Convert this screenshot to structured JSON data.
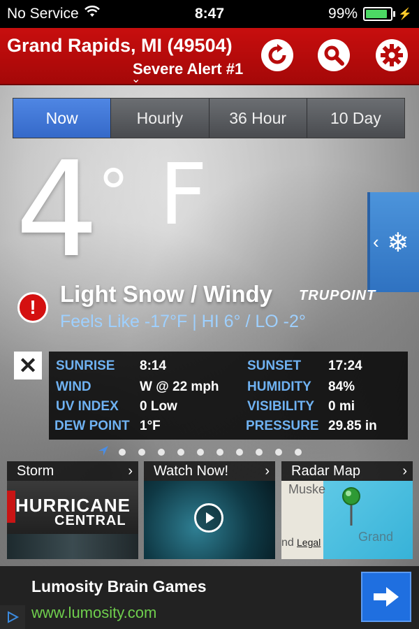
{
  "status_bar": {
    "carrier": "No Service",
    "time": "8:47",
    "battery_percent": "99%",
    "battery_level": 0.99,
    "wifi_icon": "wifi-icon",
    "charging_icon": "charging-icon"
  },
  "header": {
    "location": "Grand Rapids, MI (49504)",
    "alert_label": "Severe Alert #1",
    "alert_chevron": "⌄",
    "buttons": [
      "refresh-icon",
      "search-icon",
      "gear-icon"
    ],
    "bg_color": "#c00d0d"
  },
  "tabs": [
    {
      "label": "Now",
      "active": true
    },
    {
      "label": "Hourly",
      "active": false
    },
    {
      "label": "36 Hour",
      "active": false
    },
    {
      "label": "10 Day",
      "active": false
    }
  ],
  "current": {
    "temp_value": "4",
    "temp_degree": "°",
    "temp_unit": "F",
    "condition": "Light Snow / Windy",
    "feels_like": "Feels Like -17°F | HI 6° / LO -2°",
    "alert_icon": "!",
    "trupoint_logo": "TRUPOINT"
  },
  "side_tab": {
    "chevron": "‹",
    "icon": "❄"
  },
  "details": {
    "close_icon": "✕",
    "rows": [
      {
        "l1": "SUNRISE",
        "v1": "8:14",
        "l2": "SUNSET",
        "v2": "17:24"
      },
      {
        "l1": "WIND",
        "v1": "W @ 22 mph",
        "l2": "HUMIDITY",
        "v2": "84%"
      },
      {
        "l1": "UV INDEX",
        "v1": "0 Low",
        "l2": "VISIBILITY",
        "v2": "0 mi"
      },
      {
        "l1": "DEW POINT",
        "v1": "1°F",
        "l2": "PRESSURE",
        "v2": "29.85 in"
      }
    ]
  },
  "pager": {
    "current_icon": "location-arrow-icon",
    "dot_count": 10
  },
  "tiles": [
    {
      "header": "Storm",
      "chevron": "›",
      "line1": "HURRICANE",
      "line2": "CENTRAL"
    },
    {
      "header": "Watch Now!",
      "chevron": "›",
      "play_icon": "play-icon"
    },
    {
      "header": "Radar Map",
      "chevron": "›",
      "map_text_1": "Muske",
      "map_text_2": "Grand",
      "map_text_3": "Legal",
      "map_text_4": "nd"
    }
  ],
  "ad": {
    "title": "Lumosity Brain Games",
    "url": "www.lumosity.com",
    "button_icon": "arrow-right-icon",
    "corner_icon": "play-triangle-icon"
  },
  "colors": {
    "accent_blue": "#3b6fd0",
    "label_blue": "#6fb2f2",
    "feels_like": "#9ed0ff",
    "ad_url_green": "#6fcf4d"
  }
}
